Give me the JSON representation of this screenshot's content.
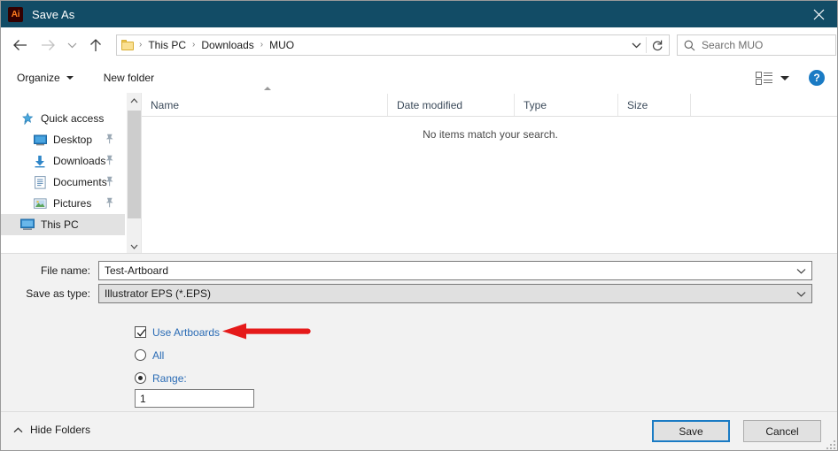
{
  "window": {
    "title": "Save As",
    "app_icon": "illustrator-ai-icon",
    "app_icon_text": "Ai",
    "titlebar_color": "#124c66",
    "close_label": "×"
  },
  "nav": {
    "back_icon": "arrow-left-icon",
    "forward_icon": "arrow-right-icon",
    "history_icon": "chevron-down-icon",
    "up_icon": "arrow-up-icon",
    "breadcrumbs": [
      "This PC",
      "Downloads",
      "MUO"
    ],
    "separator": "›",
    "dropdown_icon": "chevron-down-icon",
    "refresh_icon": "refresh-icon"
  },
  "search": {
    "icon": "search-icon",
    "placeholder": "Search MUO",
    "value": ""
  },
  "toolbar": {
    "organize_label": "Organize",
    "new_folder_label": "New folder",
    "view_icon": "view-layout-icon",
    "help_icon": "help-icon",
    "help_label": "?"
  },
  "sidebar": {
    "items": [
      {
        "label": "Quick access",
        "icon": "star-pin-icon",
        "level": 0,
        "pinned": false,
        "selected": false
      },
      {
        "label": "Desktop",
        "icon": "desktop-icon",
        "level": 1,
        "pinned": true,
        "selected": false
      },
      {
        "label": "Downloads",
        "icon": "downloads-icon",
        "level": 1,
        "pinned": true,
        "selected": false
      },
      {
        "label": "Documents",
        "icon": "documents-icon",
        "level": 1,
        "pinned": true,
        "selected": false
      },
      {
        "label": "Pictures",
        "icon": "pictures-icon",
        "level": 1,
        "pinned": true,
        "selected": false
      },
      {
        "label": "This PC",
        "icon": "this-pc-icon",
        "level": 0,
        "pinned": false,
        "selected": true
      }
    ],
    "scroll_up_icon": "chevron-up-icon",
    "scroll_down_icon": "chevron-down-icon"
  },
  "filelist": {
    "columns": [
      {
        "label": "Name",
        "sorted": "asc"
      },
      {
        "label": "Date modified",
        "sorted": ""
      },
      {
        "label": "Type",
        "sorted": ""
      },
      {
        "label": "Size",
        "sorted": ""
      }
    ],
    "rows": [],
    "empty_message": "No items match your search."
  },
  "fields": {
    "file_name_label": "File name:",
    "file_name_value": "Test-Artboard",
    "save_as_type_label": "Save as type:",
    "save_as_type_value": "Illustrator EPS (*.EPS)",
    "dropdown_icon": "chevron-down-icon"
  },
  "options": {
    "use_artboards": {
      "label": "Use Artboards",
      "checked": true
    },
    "all": {
      "label": "All",
      "selected": false
    },
    "range": {
      "label": "Range:",
      "selected": true
    },
    "range_value": "1",
    "label_color": "#2b6cb5"
  },
  "annotation": {
    "arrow": "red-left-arrow",
    "color": "#e51a1a"
  },
  "footer": {
    "hide_folders_label": "Hide Folders",
    "hide_folders_icon": "chevron-up-icon",
    "save_label": "Save",
    "cancel_label": "Cancel",
    "resize_grip": "resize-grip-icon"
  }
}
